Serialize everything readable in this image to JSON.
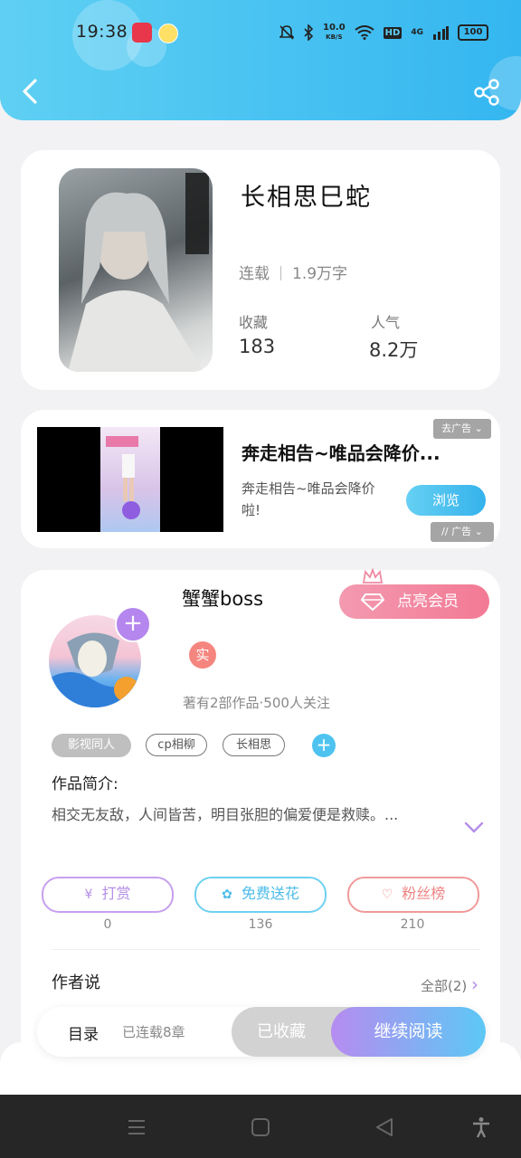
{
  "status_bar": {
    "time": "19:38",
    "net_speed_value": "10.0",
    "net_speed_unit": "KB/S",
    "hd": "HD",
    "signal": "4G",
    "battery": "100"
  },
  "book": {
    "title": "长相思巳蛇",
    "status": "连载",
    "word_count": "1.9万字",
    "favorites_label": "收藏",
    "favorites_value": "183",
    "popularity_label": "人气",
    "popularity_value": "8.2万"
  },
  "ad": {
    "title": "奔走相告~唯品会降价...",
    "description": "奔走相告~唯品会降价啦!",
    "button": "浏览",
    "tag_top": "去广告",
    "tag_bottom": "广告"
  },
  "author": {
    "name": "蟹蟹boss",
    "vip_button": "点亮会员",
    "verified_badge": "实",
    "works_info": "著有2部作品·500人关注",
    "tags": [
      "影视同人",
      "cp相柳",
      "长相思"
    ],
    "intro_label": "作品简介:",
    "intro_text": "相交无友敌，人间皆苦，明目张胆的偏爱便是救赎。...",
    "actions": [
      {
        "label": "打赏",
        "count": "0",
        "color": "#c7a0ee"
      },
      {
        "label": "免费送花",
        "count": "136",
        "color": "#6fd0f0"
      },
      {
        "label": "粉丝榜",
        "count": "210",
        "color": "#f19a9a"
      }
    ],
    "said_label": "作者说",
    "said_all": "全部(2)"
  },
  "bottom_bar": {
    "toc_label": "目录",
    "chapter_count": "已连载8章",
    "collected_button": "已收藏",
    "read_button": "继续阅读"
  }
}
